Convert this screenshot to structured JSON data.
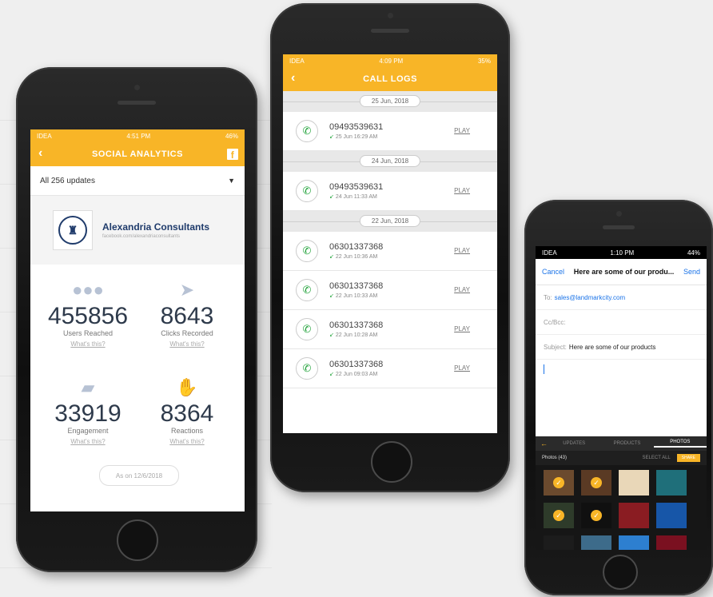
{
  "colors": {
    "accent": "#f8b527",
    "navy": "#1f3b6b",
    "call_green": "#27a53f",
    "link_blue": "#1a73e8"
  },
  "phone1": {
    "status": {
      "carrier": "IDEA",
      "time": "4:51 PM",
      "battery": "46%"
    },
    "nav_title": "SOCIAL ANALYTICS",
    "filter": "All 256 updates",
    "company_name": "Alexandria Consultants",
    "company_url": "facebook.com/alexandriaconsultants",
    "stats": [
      {
        "value": "455856",
        "label": "Users Reached",
        "link": "What's this?",
        "icon": "users-icon"
      },
      {
        "value": "8643",
        "label": "Clicks Recorded",
        "link": "What's this?",
        "icon": "cursor-icon"
      },
      {
        "value": "33919",
        "label": "Engagement",
        "link": "What's this?",
        "icon": "chat-icon"
      },
      {
        "value": "8364",
        "label": "Reactions",
        "link": "What's this?",
        "icon": "thumbs-up-icon"
      }
    ],
    "as_on": "As on 12/6/2018"
  },
  "phone2": {
    "status": {
      "carrier": "IDEA",
      "time": "4:09 PM",
      "battery": "35%"
    },
    "nav_title": "CALL LOGS",
    "play_label": "PLAY",
    "groups": [
      {
        "date": "25 Jun, 2018",
        "calls": [
          {
            "number": "09493539631",
            "time": "25 Jun 16:29 AM"
          }
        ]
      },
      {
        "date": "24 Jun, 2018",
        "calls": [
          {
            "number": "09493539631",
            "time": "24 Jun 11:33 AM"
          }
        ]
      },
      {
        "date": "22 Jun, 2018",
        "calls": [
          {
            "number": "06301337368",
            "time": "22 Jun 10:36 AM"
          },
          {
            "number": "06301337368",
            "time": "22 Jun 10:33 AM"
          },
          {
            "number": "06301337368",
            "time": "22 Jun 10:28 AM"
          },
          {
            "number": "06301337368",
            "time": "22 Jun 09:03 AM"
          }
        ]
      }
    ]
  },
  "phone3": {
    "status": {
      "carrier": "IDEA",
      "time": "1:10 PM",
      "battery": "44%"
    },
    "cancel": "Cancel",
    "subject_head": "Here are some of our produ...",
    "send": "Send",
    "to_label": "To:",
    "to_value": "sales@landmarkcity.com",
    "cc_label": "Cc/Bcc:",
    "subject_label": "Subject:",
    "subject_value": "Here are some of our products",
    "tabs": [
      "UPDATES",
      "PRODUCTS",
      "PHOTOS"
    ],
    "photos_count": "Photos (43)",
    "select_all": "SELECT ALL",
    "share": "SHARE",
    "thumb_colors": [
      "#6b4a2e",
      "#5a3a24",
      "#e9d7b8",
      "#1f6f7a",
      "#2e3b2a",
      "#101010",
      "#8a1c22",
      "#1756a8",
      "#1c1c1c",
      "#3d6b8a",
      "#2d7fd0",
      "#7a1020"
    ]
  }
}
